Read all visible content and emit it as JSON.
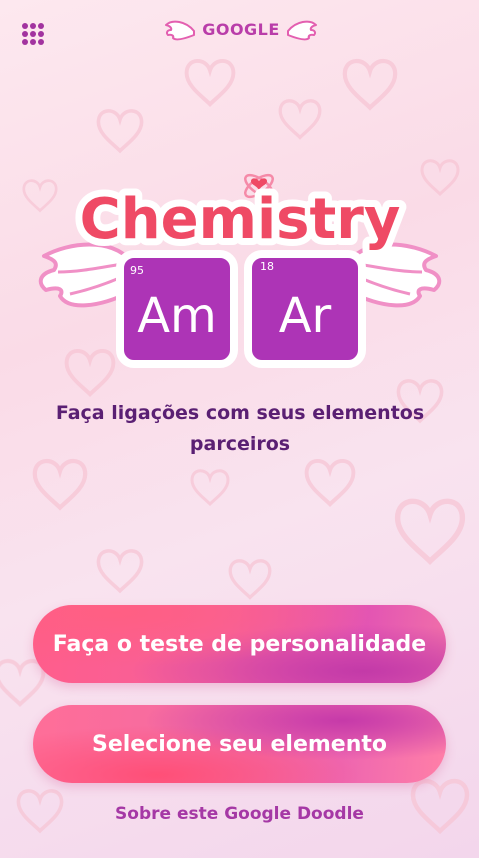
{
  "header": {
    "apps_icon": "grid-icon",
    "brand_text": "GOOGLE"
  },
  "logo": {
    "title": "Chemistry",
    "elements": [
      {
        "number": "95",
        "symbol": "Am"
      },
      {
        "number": "18",
        "symbol": "Ar"
      }
    ],
    "decorations": [
      "heart-icon",
      "wing-icon"
    ]
  },
  "tagline": "Faça ligações com seus elementos parceiros",
  "buttons": {
    "quiz_label": "Faça o teste de personalidade",
    "select_label": "Selecione seu elemento"
  },
  "footer": {
    "about_link": "Sobre este Google Doodle"
  },
  "colors": {
    "accent_purple": "#b93da9",
    "title_red": "#ef4a65",
    "tile_purple": "#ad34b6",
    "text_dark": "#5a1f73"
  }
}
